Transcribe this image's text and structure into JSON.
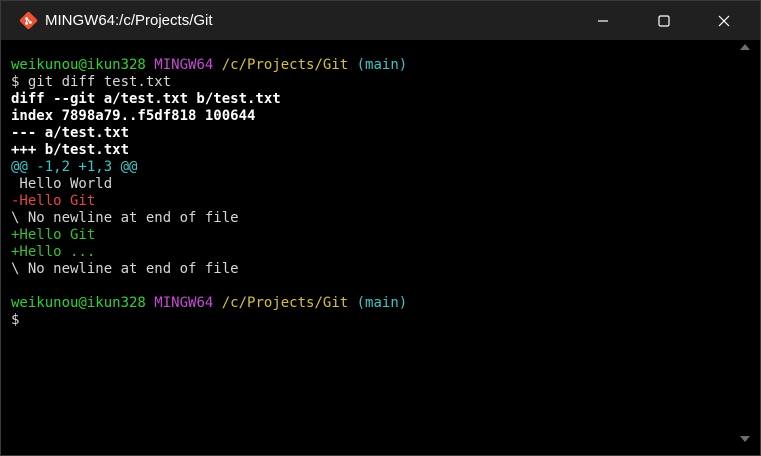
{
  "window": {
    "title": "MINGW64:/c/Projects/Git",
    "controls": {
      "minimize_icon": "minimize-icon",
      "maximize_icon": "maximize-icon",
      "close_icon": "close-icon"
    }
  },
  "colors": {
    "user": "#2fd13a",
    "system": "#c74ad6",
    "path": "#d6c23a",
    "branch": "#3cc6c8",
    "deleted": "#e04848",
    "added": "#3bbf35"
  },
  "terminal": {
    "prompt1": {
      "user_host": "weikunou@ikun328",
      "system": "MINGW64",
      "path": "/c/Projects/Git",
      "branch": "(main)"
    },
    "command": "$ git diff test.txt",
    "diff_header": "diff --git a/test.txt b/test.txt",
    "index_line": "index 7898a79..f5df818 100644",
    "old_file": "--- a/test.txt",
    "new_file": "+++ b/test.txt",
    "hunk": "@@ -1,2 +1,3 @@",
    "context_line": " Hello World",
    "removed_line": "-Hello Git",
    "no_newline_1": "\\ No newline at end of file",
    "added_line_1": "+Hello Git",
    "added_line_2": "+Hello ...",
    "no_newline_2": "\\ No newline at end of file",
    "prompt2": {
      "user_host": "weikunou@ikun328",
      "system": "MINGW64",
      "path": "/c/Projects/Git",
      "branch": "(main)"
    },
    "final_prompt": "$"
  }
}
